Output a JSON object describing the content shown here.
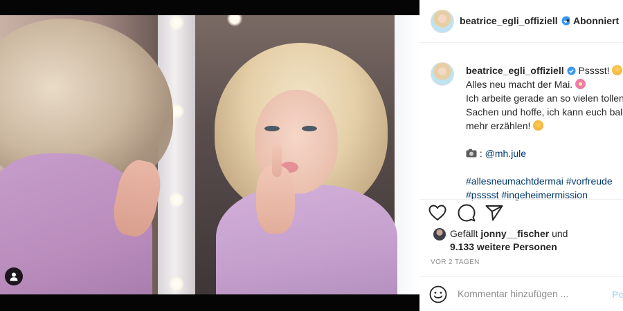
{
  "header": {
    "username": "beatrice_egli_offiziell",
    "separator": "•",
    "follow_status": "Abonniert"
  },
  "caption": {
    "username": "beatrice_egli_offiziell",
    "line1": "Psssst!",
    "line2": "Alles neu macht der Mai.",
    "line3": "Ich arbeite gerade an so vielen tollen",
    "line4": "Sachen und hoffe, ich kann euch bald",
    "line5": "mehr erzählen!",
    "credit_handle": "@mh.jule",
    "hashtags_line1": "#allesneumachtdermai #vorfreude",
    "hashtags_line2": "#psssst #ingeheimermission"
  },
  "likes": {
    "prefix": "Gefällt",
    "liker": "jonny__fischer",
    "conjunction": "und",
    "others": "9.133 weitere Personen"
  },
  "timestamp": "VOR 2 TAGEN",
  "comment": {
    "placeholder": "Kommentar hinzufügen ...",
    "post_label": "Posten"
  },
  "icons": {
    "like": "heart-icon",
    "comment": "speech-bubble-icon",
    "share": "paper-plane-icon",
    "emoji": "smiley-icon",
    "user_tag": "person-icon",
    "verified": "verified-badge-icon"
  },
  "colors": {
    "verified_blue": "#3897f0",
    "link_blue": "#00376b",
    "post_button_disabled": "#b2dffc",
    "muted_text": "#8e8e8e"
  }
}
